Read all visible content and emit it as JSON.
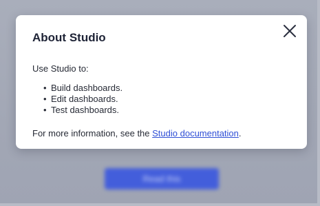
{
  "background": {
    "button_label": "Read this"
  },
  "dialog": {
    "title": "About Studio",
    "intro": "Use Studio to:",
    "items": [
      "Build dashboards.",
      "Edit dashboards.",
      "Test dashboards."
    ],
    "more_prefix": "For more information, see the ",
    "more_link": "Studio documentation",
    "more_suffix": ".",
    "close_icon": "close-icon"
  },
  "colors": {
    "title_text": "#1e2336",
    "body_text": "#262a35",
    "link": "#2f4fd6",
    "backdrop": "#a4a9b6",
    "background_button": "#3a57e0"
  }
}
